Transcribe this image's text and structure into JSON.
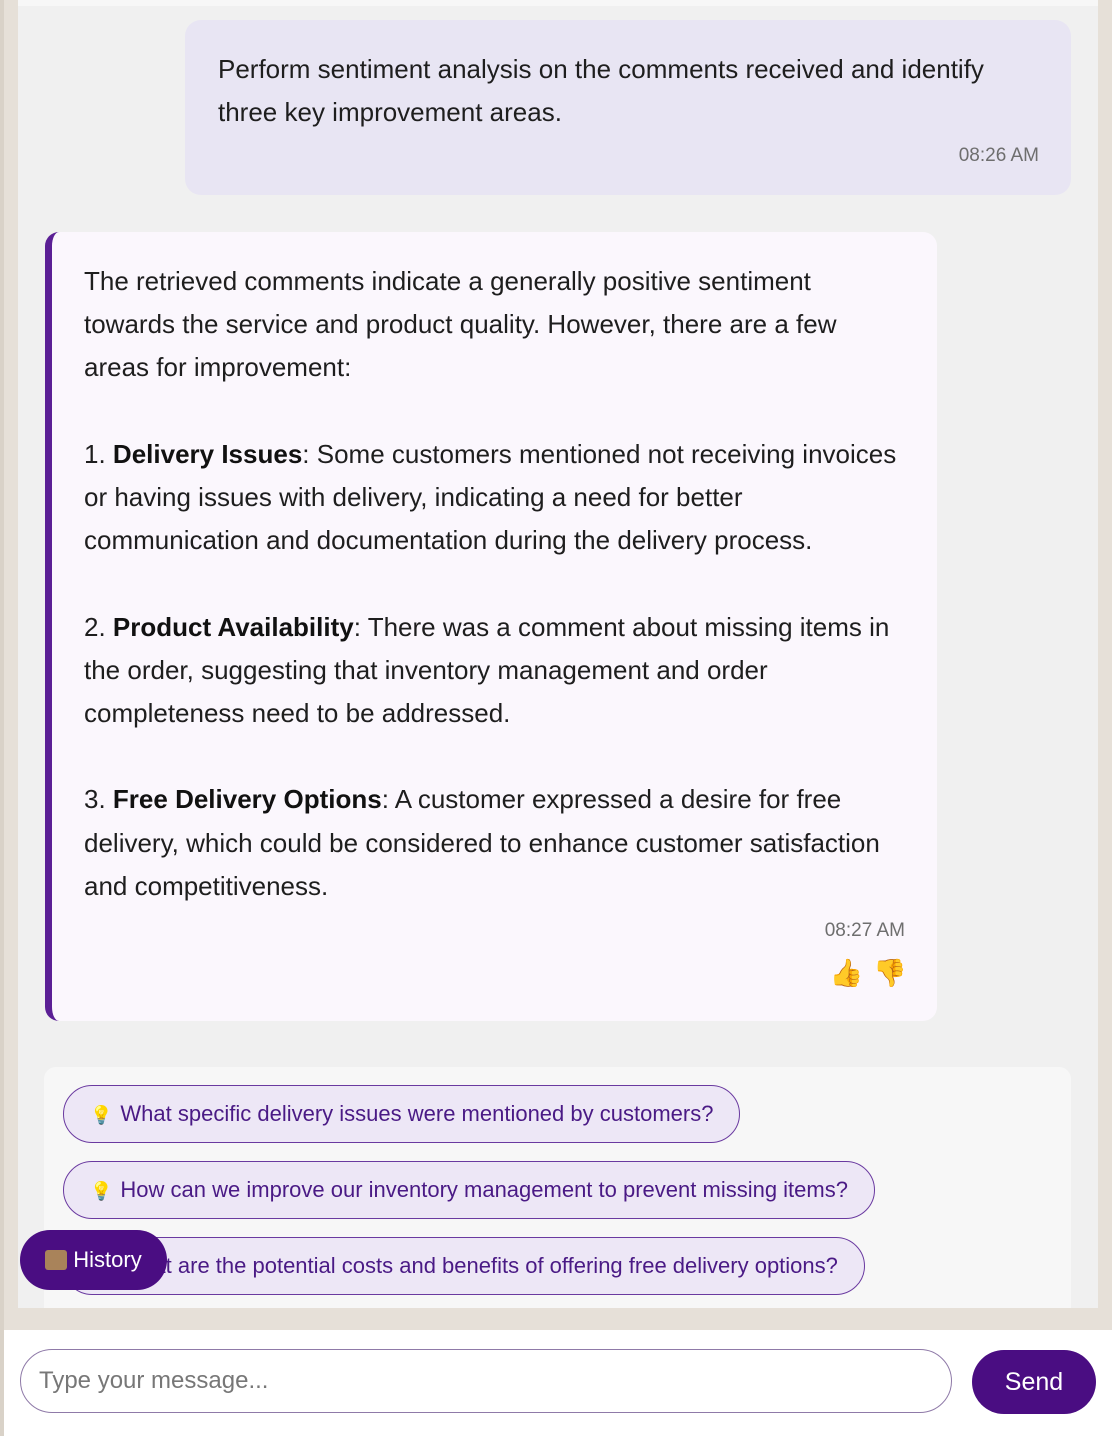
{
  "conversation": {
    "user_message": {
      "text": "Perform sentiment analysis on the comments received and identify three key improvement areas.",
      "time": "08:26 AM"
    },
    "bot_message": {
      "intro": "The retrieved comments indicate a generally positive sentiment towards the service and product quality. However, there are a few areas for improvement:",
      "points": [
        {
          "num": "1.",
          "title": "Delivery Issues",
          "body": ": Some customers mentioned not receiving invoices or having issues with delivery, indicating a need for better communication and documentation during the delivery process."
        },
        {
          "num": "2.",
          "title": "Product Availability",
          "body": ": There was a comment about missing items in the order, suggesting that inventory management and order completeness need to be addressed."
        },
        {
          "num": "3.",
          "title": "Free Delivery Options",
          "body": ": A customer expressed a desire for free delivery, which could be considered to enhance customer satisfaction and competitiveness."
        }
      ],
      "time": "08:27 AM",
      "thumbs_up": "👍",
      "thumbs_down": "👎"
    }
  },
  "suggestions": {
    "bulb": "💡",
    "items": [
      "What specific delivery issues were mentioned by customers?",
      "How can we improve our inventory management to prevent missing items?",
      "What are the potential costs and benefits of offering free delivery options?"
    ]
  },
  "history_button": {
    "label": "History",
    "icon": "scroll-icon"
  },
  "composer": {
    "placeholder": "Type your message...",
    "send_label": "Send"
  },
  "colors": {
    "accent": "#4a0d82",
    "user_bubble": "#e8e5f3",
    "bot_bubble": "#fbf7fd",
    "bot_border": "#5b1f95"
  }
}
